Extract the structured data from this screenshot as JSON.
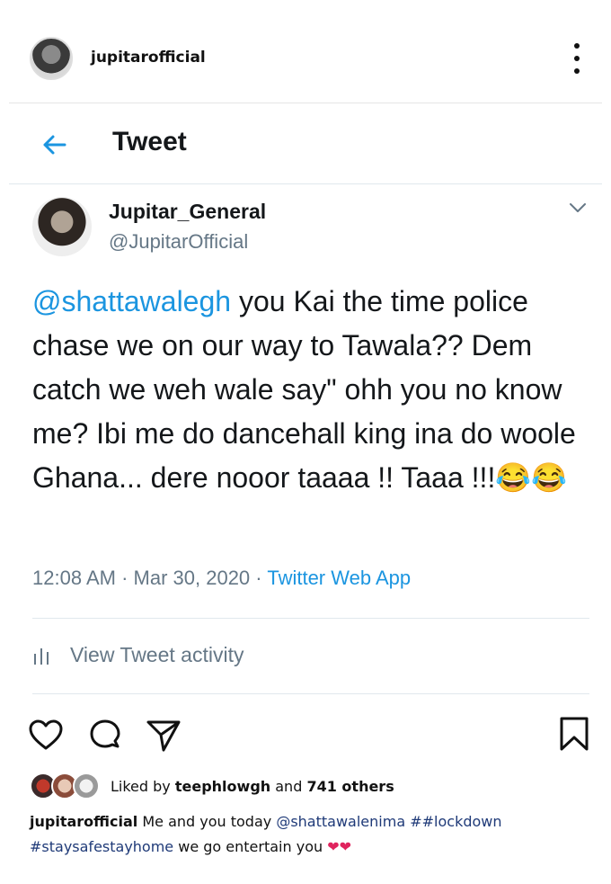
{
  "instagram": {
    "username": "jupitarofficial",
    "liked_by_prefix": "Liked by",
    "liked_by_user": "teephlowgh",
    "liked_by_and": "and",
    "liked_by_others": "741 others",
    "caption_user": "jupitarofficial",
    "caption_text_1": "Me and you today",
    "caption_mention": "@shattawalenima",
    "caption_tag_1": "##lockdown",
    "caption_tag_2": "#staysafestayhome",
    "caption_text_2": "we go entertain you",
    "caption_emoji": "❤❤"
  },
  "tweet": {
    "header_title": "Tweet",
    "display_name": "Jupitar_General",
    "handle": "@JupitarOfficial",
    "mention": "@shattawalegh",
    "text": " you Kai the time police chase we on our way to Tawala?? Dem catch we weh wale say\" ohh you no know me? Ibi me do dancehall king ina do woole Ghana... dere nooor taaaa !! Taaa !!!😂😂",
    "time": "12:08 AM",
    "sep1": "·",
    "date": "Mar 30, 2020",
    "sep2": "·",
    "source": "Twitter Web App",
    "activity_label": "View Tweet activity"
  },
  "colors": {
    "twitter_blue": "#1b95e0",
    "secondary_gray": "#657786",
    "ig_tag_blue": "#1f3a78"
  },
  "icons": [
    "more-vertical-icon",
    "back-arrow-icon",
    "chevron-down-icon",
    "bar-chart-icon",
    "heart-icon",
    "comment-icon",
    "share-icon",
    "bookmark-icon"
  ]
}
